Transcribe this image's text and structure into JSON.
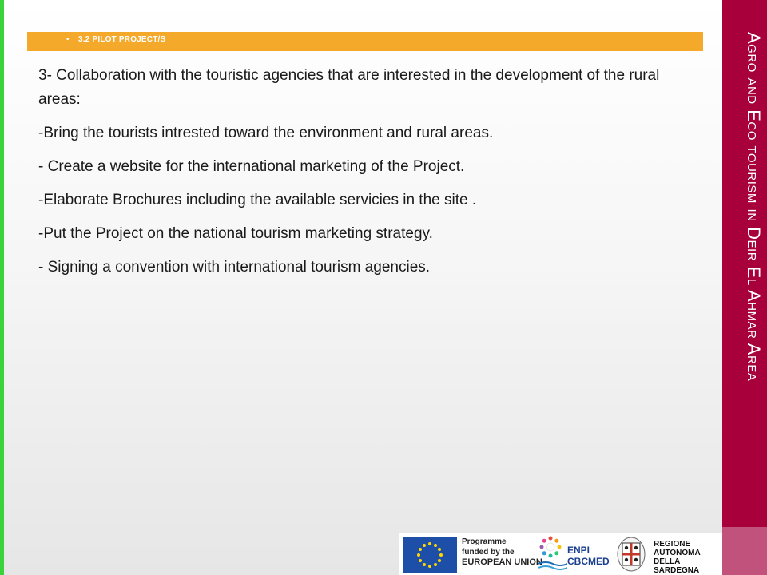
{
  "header": {
    "bullet": "•",
    "section_label": "3.2 PILOT PROJECT/S"
  },
  "content": {
    "paragraphs": [
      "3- Collaboration with the touristic agencies that are interested in the development of the rural areas:",
      "-Bring the tourists intrested toward  the environment and rural areas.",
      "- Create a website for the international marketing of the Project.",
      "-Elaborate Brochures including the available servicies in the site .",
      "-Put the Project on the national tourism marketing strategy.",
      "- Signing a convention with international tourism agencies."
    ]
  },
  "sidebar": {
    "title": "Agro and Eco tourism  in Deir El Ahmar Area"
  },
  "footer_logos": {
    "eu": {
      "line1": "Programme",
      "line2": "funded by the",
      "line3": "EUROPEAN UNION"
    },
    "enpi": {
      "line1": "ENPI",
      "line2": "CBCMED"
    },
    "sardegna": {
      "line1": "REGIONE",
      "line2": "AUTONOMA",
      "line3": "DELLA SARDEGNA"
    }
  },
  "colors": {
    "band": "#f4a92a",
    "sidebar": "#a8003a",
    "sidebar_accent": "#c0527b",
    "left_edge": "#3bd33b",
    "eu_blue": "#1e4fa8",
    "eu_star": "#ffd700"
  }
}
